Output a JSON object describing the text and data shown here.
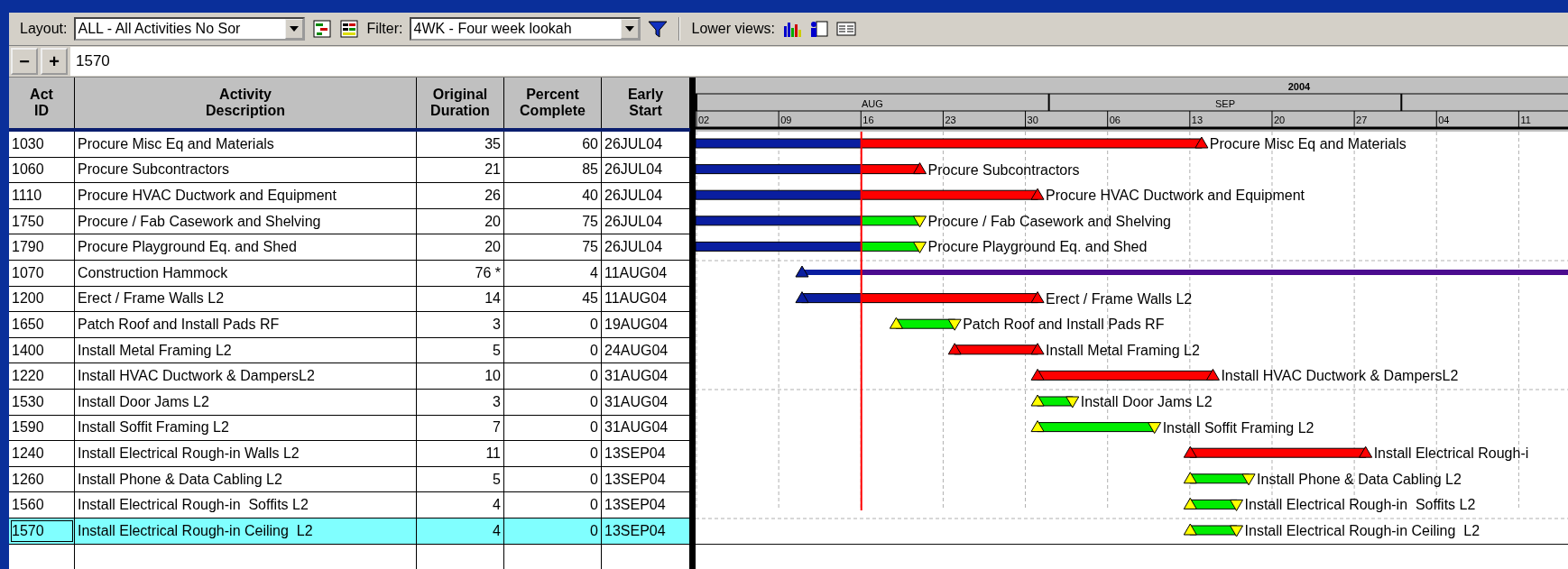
{
  "toolbar": {
    "layout_label": "Layout:",
    "layout_value": "ALL - All Activities No Sor",
    "filter_label": "Filter:",
    "filter_value": "4WK - Four week lookah",
    "lower_views_label": "Lower views:"
  },
  "edit_bar": {
    "collapse": "−",
    "expand": "+",
    "value": "1570"
  },
  "table": {
    "columns": [
      "Act ID",
      "Activity Description",
      "Original Duration",
      "Percent Complete",
      "Early Start"
    ],
    "rows": [
      {
        "id": "1030",
        "description": "Procure Misc Eq and Materials",
        "duration": "35",
        "percent": "60",
        "early_start": "26JUL04",
        "selected": false,
        "bar": {
          "kind": "critical",
          "finish": {
            "level": 0.58
          },
          "started": true,
          "label": "Procure Misc Eq and Materials"
        }
      },
      {
        "id": "1060",
        "description": "Procure Subcontractors",
        "duration": "21",
        "percent": "85",
        "early_start": "26JUL04",
        "selected": false,
        "bar": {
          "kind": "critical",
          "finish": {
            "level": 0.257
          },
          "started": true,
          "label": "Procure Subcontractors"
        }
      },
      {
        "id": "1110",
        "description": "Procure HVAC Ductwork and Equipment",
        "duration": "26",
        "percent": "40",
        "early_start": "26JUL04",
        "selected": false,
        "bar": {
          "kind": "critical",
          "finish": {
            "level": 0.392
          },
          "started": true,
          "label": "Procure HVAC Ductwork and Equipment"
        }
      },
      {
        "id": "1750",
        "description": "Procure / Fab Casework and Shelving",
        "duration": "20",
        "percent": "75",
        "early_start": "26JUL04",
        "selected": false,
        "bar": {
          "kind": "noncritical",
          "finish": {
            "level": 0.257
          },
          "started": true,
          "label": "Procure / Fab Casework and Shelving"
        }
      },
      {
        "id": "1790",
        "description": "Procure Playground Eq. and Shed",
        "duration": "20",
        "percent": "75",
        "early_start": "26JUL04",
        "selected": false,
        "bar": {
          "kind": "noncritical",
          "finish": {
            "level": 0.257
          },
          "started": true,
          "label": "Procure Playground Eq. and Shed"
        }
      },
      {
        "id": "1070",
        "description": "Construction Hammock",
        "duration": "76 *",
        "percent": "4",
        "early_start": "11AUG04",
        "selected": false,
        "bar": {
          "kind": "hammock",
          "start": {
            "level": 0.122
          },
          "started": true
        }
      },
      {
        "id": "1200",
        "description": "Erect / Frame Walls L2",
        "duration": "14",
        "percent": "45",
        "early_start": "11AUG04",
        "selected": false,
        "bar": {
          "kind": "critical",
          "start": {
            "level": 0.122
          },
          "finish": {
            "level": 0.392
          },
          "started": true,
          "label": "Erect / Frame Walls L2"
        }
      },
      {
        "id": "1650",
        "description": "Patch Roof and Install Pads RF",
        "duration": "3",
        "percent": "0",
        "early_start": "19AUG04",
        "selected": false,
        "bar": {
          "kind": "noncritical",
          "start": {
            "level": 0.23
          },
          "finish": {
            "level": 0.297
          },
          "started": false,
          "label": "Patch Roof and Install Pads RF"
        }
      },
      {
        "id": "1400",
        "description": "Install Metal Framing L2",
        "duration": "5",
        "percent": "0",
        "early_start": "24AUG04",
        "selected": false,
        "bar": {
          "kind": "critical",
          "start": {
            "level": 0.297
          },
          "finish": {
            "level": 0.392
          },
          "started": false,
          "label": "Install Metal Framing L2"
        }
      },
      {
        "id": "1220",
        "description": "Install HVAC Ductwork & DampersL2",
        "duration": "10",
        "percent": "0",
        "early_start": "31AUG04",
        "selected": false,
        "bar": {
          "kind": "critical",
          "start": {
            "level": 0.392
          },
          "finish": {
            "level": 0.593
          },
          "started": false,
          "label": "Install HVAC Ductwork & DampersL2"
        }
      },
      {
        "id": "1530",
        "description": "Install Door Jams L2",
        "duration": "3",
        "percent": "0",
        "early_start": "31AUG04",
        "selected": false,
        "bar": {
          "kind": "noncritical",
          "start": {
            "level": 0.392
          },
          "finish": {
            "level": 0.432
          },
          "started": false,
          "label": "Install Door Jams L2"
        }
      },
      {
        "id": "1590",
        "description": "Install Soffit Framing L2",
        "duration": "7",
        "percent": "0",
        "early_start": "31AUG04",
        "selected": false,
        "bar": {
          "kind": "noncritical",
          "start": {
            "level": 0.392
          },
          "finish": {
            "level": 0.526
          },
          "started": false,
          "label": "Install Soffit Framing L2"
        }
      },
      {
        "id": "1240",
        "description": "Install Electrical Rough-in Walls L2",
        "duration": "11",
        "percent": "0",
        "early_start": "13SEP04",
        "selected": false,
        "bar": {
          "kind": "critical",
          "start": {
            "level": 0.567
          },
          "finish": {
            "level": 0.768
          },
          "started": false,
          "label": "Install Electrical Rough-i"
        }
      },
      {
        "id": "1260",
        "description": "Install Phone & Data Cabling L2",
        "duration": "5",
        "percent": "0",
        "early_start": "13SEP04",
        "selected": false,
        "bar": {
          "kind": "noncritical",
          "start": {
            "level": 0.567
          },
          "finish": {
            "level": 0.634
          },
          "started": false,
          "label": "Install Phone & Data Cabling L2"
        }
      },
      {
        "id": "1560",
        "description": "Install Electrical Rough-in  Soffits L2",
        "duration": "4",
        "percent": "0",
        "early_start": "13SEP04",
        "selected": false,
        "bar": {
          "kind": "noncritical",
          "start": {
            "level": 0.567
          },
          "finish": {
            "level": 0.62
          },
          "started": false,
          "label": "Install Electrical Rough-in  Soffits L2"
        }
      },
      {
        "id": "1570",
        "description": "Install Electrical Rough-in Ceiling  L2",
        "duration": "4",
        "percent": "0",
        "early_start": "13SEP04",
        "selected": true,
        "bar": {
          "kind": "noncritical",
          "start": {
            "level": 0.567
          },
          "finish": {
            "level": 0.62
          },
          "started": false,
          "label": "Install Electrical Rough-in Ceiling  L2"
        }
      }
    ]
  },
  "gantt": {
    "data_date": {
      "level": 0.19
    },
    "year": "2004",
    "months": [
      {
        "label": "AUG",
        "start": {
          "level": 0
        }
      },
      {
        "label": "SEP",
        "start": {
          "level": 0.405
        }
      },
      {
        "start": {
          "level": 0.809
        }
      }
    ],
    "weeks": [
      "02",
      "09",
      "16",
      "23",
      "30",
      "06",
      "13",
      "20",
      "27",
      "04",
      "11"
    ]
  }
}
